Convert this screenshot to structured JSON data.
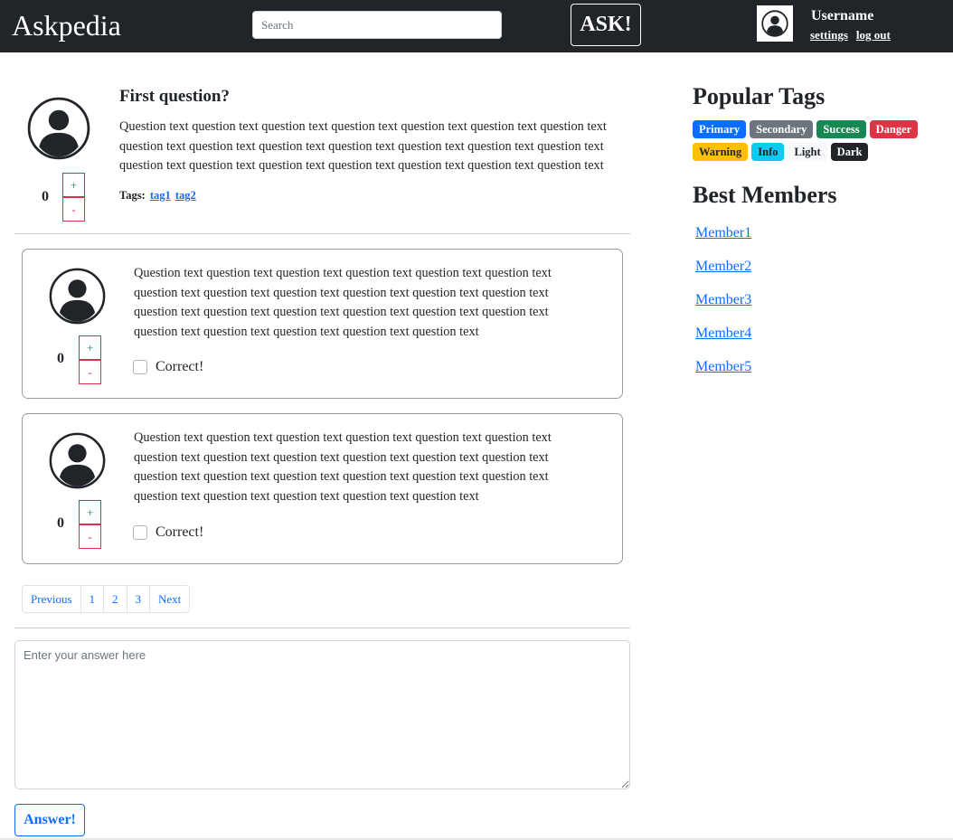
{
  "navbar": {
    "brand": "Askpedia",
    "search_placeholder": "Search",
    "ask_label": "ASK!",
    "username": "Username",
    "settings_label": "settings",
    "logout_label": "log out"
  },
  "question": {
    "title": "First question?",
    "text": "Question text question text question text question text question text question text question text question text question text question text question text question text question text question text question text question text question text question text question text question text question text",
    "votes": "0",
    "plus_label": "+",
    "minus_label": "-",
    "tags_label": "Tags:",
    "tags": [
      "tag1",
      "tag2"
    ]
  },
  "answers": [
    {
      "text": "Question text question text question text question text question text question text question text question text question text question text question text question text question text question text question text question text question text question text question text question text question text question text question text",
      "votes": "0",
      "plus_label": "+",
      "minus_label": "-",
      "correct_label": "Correct!",
      "correct_checked": false
    },
    {
      "text": "Question text question text question text question text question text question text question text question text question text question text question text question text question text question text question text question text question text question text question text question text question text question text question text",
      "votes": "0",
      "plus_label": "+",
      "minus_label": "-",
      "correct_label": "Correct!",
      "correct_checked": false
    }
  ],
  "pagination": [
    "Previous",
    "1",
    "2",
    "3",
    "Next"
  ],
  "answer_form": {
    "placeholder": "Enter your answer here",
    "submit_label": "Answer!"
  },
  "sidebar": {
    "tags_title": "Popular Tags",
    "tags": [
      {
        "label": "Primary",
        "bg": "#0d6efd",
        "color": "#ffffff"
      },
      {
        "label": "Secondary",
        "bg": "#6c757d",
        "color": "#ffffff"
      },
      {
        "label": "Success",
        "bg": "#198754",
        "color": "#ffffff"
      },
      {
        "label": "Danger",
        "bg": "#dc3545",
        "color": "#ffffff"
      },
      {
        "label": "Warning",
        "bg": "#ffc107",
        "color": "#212529"
      },
      {
        "label": "Info",
        "bg": "#0dcaf0",
        "color": "#212529"
      },
      {
        "label": "Light",
        "bg": "#f8f9fa",
        "color": "#212529"
      },
      {
        "label": "Dark",
        "bg": "#212529",
        "color": "#ffffff"
      }
    ],
    "members_title": "Best Members",
    "members": [
      "Member1",
      "Member2",
      "Member3",
      "Member4",
      "Member5"
    ]
  },
  "icons": {
    "avatar": "user-avatar-icon"
  }
}
